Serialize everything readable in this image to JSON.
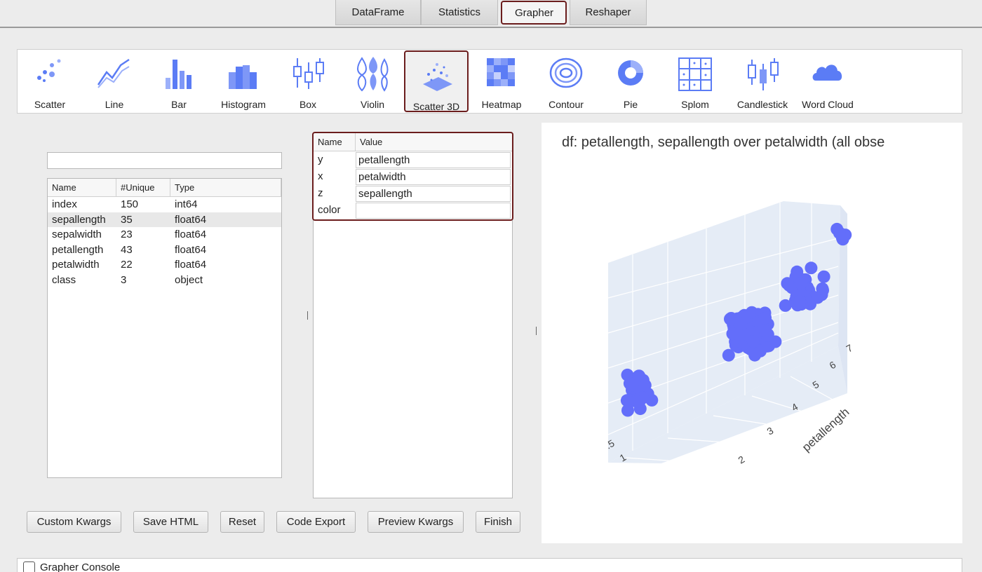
{
  "tabs": [
    "DataFrame",
    "Statistics",
    "Grapher",
    "Reshaper"
  ],
  "active_tab": "Grapher",
  "chart_types": [
    {
      "label": "Scatter",
      "icon": "scatter-icon"
    },
    {
      "label": "Line",
      "icon": "line-chart-icon"
    },
    {
      "label": "Bar",
      "icon": "bar-chart-icon"
    },
    {
      "label": "Histogram",
      "icon": "histogram-icon"
    },
    {
      "label": "Box",
      "icon": "box-plot-icon"
    },
    {
      "label": "Violin",
      "icon": "violin-icon"
    },
    {
      "label": "Scatter 3D",
      "icon": "scatter-3d-icon"
    },
    {
      "label": "Heatmap",
      "icon": "heatmap-icon"
    },
    {
      "label": "Contour",
      "icon": "contour-icon"
    },
    {
      "label": "Pie",
      "icon": "pie-icon"
    },
    {
      "label": "Splom",
      "icon": "splom-icon"
    },
    {
      "label": "Candlestick",
      "icon": "candlestick-icon"
    },
    {
      "label": "Word Cloud",
      "icon": "word-cloud-icon"
    }
  ],
  "selected_chart": "Scatter 3D",
  "accent_color": "#6b1d1d",
  "icon_color": "#5b7cf5",
  "filter": {
    "value": ""
  },
  "columns": {
    "headers": [
      "Name",
      "#Unique",
      "Type"
    ],
    "rows": [
      [
        "index",
        "150",
        "int64"
      ],
      [
        "sepallength",
        "35",
        "float64"
      ],
      [
        "sepalwidth",
        "23",
        "float64"
      ],
      [
        "petallength",
        "43",
        "float64"
      ],
      [
        "petalwidth",
        "22",
        "float64"
      ],
      [
        "class",
        "3",
        "object"
      ]
    ],
    "highlighted_row": 1
  },
  "properties": {
    "headers": [
      "Name",
      "Value"
    ],
    "rows": [
      [
        "y",
        "petallength"
      ],
      [
        "x",
        "petalwidth"
      ],
      [
        "z",
        "sepallength"
      ],
      [
        "color",
        ""
      ]
    ]
  },
  "plot": {
    "title": "df: petallength, sepallength  over petalwidth (all obse",
    "axis_title": "petallength",
    "y_ticks": [
      "2",
      "3",
      "4",
      "5",
      "6",
      "7"
    ],
    "x_ticks": [
      ".5",
      "1"
    ],
    "marker_color": "#636efa"
  },
  "chart_data": {
    "type": "scatter",
    "title": "df: petallength, sepallength  over petalwidth (all obse",
    "series": [
      {
        "values": "iris petallength vs sepallength vs petalwidth (150 points)"
      }
    ],
    "axes": {
      "petallength_ticks": [
        2,
        3,
        4,
        5,
        6,
        7
      ],
      "petalwidth_ticks": [
        0.5,
        1
      ]
    },
    "grid": true
  },
  "buttons": [
    "Custom Kwargs",
    "Save HTML",
    "Reset",
    "Code Export",
    "Preview Kwargs",
    "Finish"
  ],
  "console": {
    "label": "Grapher Console",
    "checked": false
  }
}
